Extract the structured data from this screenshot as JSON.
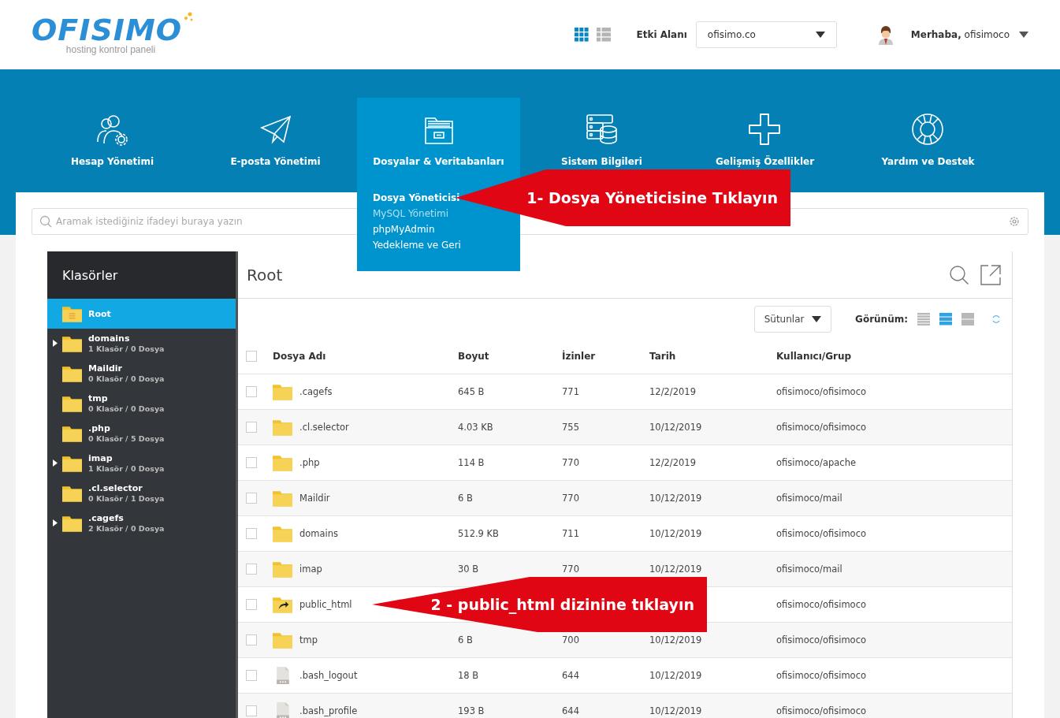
{
  "header": {
    "logo": {
      "name": "OFISIMO",
      "tagline": "hosting kontrol paneli"
    },
    "view_toggles": [
      {
        "kind": "grid",
        "selected": true
      },
      {
        "kind": "list",
        "selected": false
      }
    ],
    "domain_label": "Etki Alanı",
    "domain_select": {
      "value": "ofisimo.co"
    },
    "user_greeting": "**Merhaba,** ofisimoco"
  },
  "nav": {
    "items": [
      {
        "kind": "users",
        "label": "Hesap Yönetimi",
        "selected": false
      },
      {
        "kind": "mail",
        "label": "E-posta Yönetimi",
        "selected": false
      },
      {
        "kind": "files",
        "label": "Dosyalar & Veritabanları",
        "selected": true,
        "submenu": [
          {
            "label": "Dosya Yöneticisi",
            "selected": true,
            "dimmed": false
          },
          {
            "label": "MySQL Yönetimi",
            "selected": false,
            "dimmed": true
          },
          {
            "label": "phpMyAdmin",
            "selected": false,
            "dimmed": false
          },
          {
            "label": "Yedekleme ve Geri",
            "selected": false,
            "dimmed": false
          }
        ]
      },
      {
        "kind": "server",
        "label": "Sistem Bilgileri",
        "selected": false
      },
      {
        "kind": "plus",
        "label": "Gelişmiş Özellikler",
        "selected": false
      },
      {
        "kind": "help",
        "label": "Yardım ve Destek",
        "selected": false
      }
    ]
  },
  "search": {
    "placeholder": "Aramak istediğiniz ifadeyi buraya yazın"
  },
  "sidebar": {
    "title": "Klasörler",
    "items": [
      {
        "name": "Root",
        "selected": true,
        "expandable": false
      },
      {
        "name": "domains",
        "meta": "1 Klasör / 0 Dosya",
        "selected": false,
        "expandable": true
      },
      {
        "name": "Maildir",
        "meta": "0 Klasör / 0 Dosya",
        "selected": false,
        "expandable": false
      },
      {
        "name": "tmp",
        "meta": "0 Klasör / 0 Dosya",
        "selected": false,
        "expandable": false
      },
      {
        "name": ".php",
        "meta": "0 Klasör / 5 Dosya",
        "selected": false,
        "expandable": false
      },
      {
        "name": "imap",
        "meta": "1 Klasör / 0 Dosya",
        "selected": false,
        "expandable": true
      },
      {
        "name": ".cl.selector",
        "meta": "0 Klasör / 1 Dosya",
        "selected": false,
        "expandable": false
      },
      {
        "name": ".cagefs",
        "meta": "2 Klasör / 0 Dosya",
        "selected": false,
        "expandable": true
      }
    ]
  },
  "main": {
    "title": "Root",
    "columns_button": "Sütunlar",
    "view_label": "Görünüm:",
    "views": [
      {
        "kind": "compact",
        "selected": false
      },
      {
        "kind": "detail",
        "selected": true
      },
      {
        "kind": "large",
        "selected": false
      }
    ],
    "table": {
      "header_checked": false,
      "columns": [
        "Dosya Adı",
        "Boyut",
        "İzinler",
        "Tarih",
        "Kullanıcı/Grup"
      ],
      "rows": [
        {
          "kind": "folder",
          "checked": false,
          "name": ".cagefs",
          "size": "645 B",
          "perms": "771",
          "date": "12/2/2019",
          "owner": "ofisimoco/ofisimoco"
        },
        {
          "kind": "folder",
          "checked": false,
          "name": ".cl.selector",
          "size": "4.03 KB",
          "perms": "755",
          "date": "10/12/2019",
          "owner": "ofisimoco/ofisimoco"
        },
        {
          "kind": "folder",
          "checked": false,
          "name": ".php",
          "size": "114 B",
          "perms": "770",
          "date": "12/2/2019",
          "owner": "ofisimoco/apache"
        },
        {
          "kind": "folder",
          "checked": false,
          "name": "Maildir",
          "size": "6 B",
          "perms": "770",
          "date": "10/12/2019",
          "owner": "ofisimoco/mail"
        },
        {
          "kind": "folder",
          "checked": false,
          "name": "domains",
          "size": "512.9 KB",
          "perms": "711",
          "date": "10/12/2019",
          "owner": "ofisimoco/ofisimoco"
        },
        {
          "kind": "folder",
          "checked": false,
          "name": "imap",
          "size": "30 B",
          "perms": "770",
          "date": "10/12/2019",
          "owner": "ofisimoco/mail"
        },
        {
          "kind": "link",
          "checked": false,
          "name": "public_html",
          "owner": "ofisimoco/ofisimoco"
        },
        {
          "kind": "folder",
          "checked": false,
          "name": "tmp",
          "size": "6 B",
          "perms": "700",
          "date": "10/12/2019",
          "owner": "ofisimoco/ofisimoco"
        },
        {
          "kind": "file",
          "checked": false,
          "name": ".bash_logout",
          "size": "18 B",
          "perms": "644",
          "date": "10/12/2019",
          "owner": "ofisimoco/ofisimoco"
        },
        {
          "kind": "file",
          "checked": false,
          "name": ".bash_profile",
          "size": "193 B",
          "perms": "644",
          "date": "10/12/2019",
          "owner": "ofisimoco/ofisimoco"
        }
      ]
    }
  },
  "callouts": [
    "1- Dosya Yöneticisine Tıklayın",
    "2 - public_html dizinine tıklayın"
  ]
}
